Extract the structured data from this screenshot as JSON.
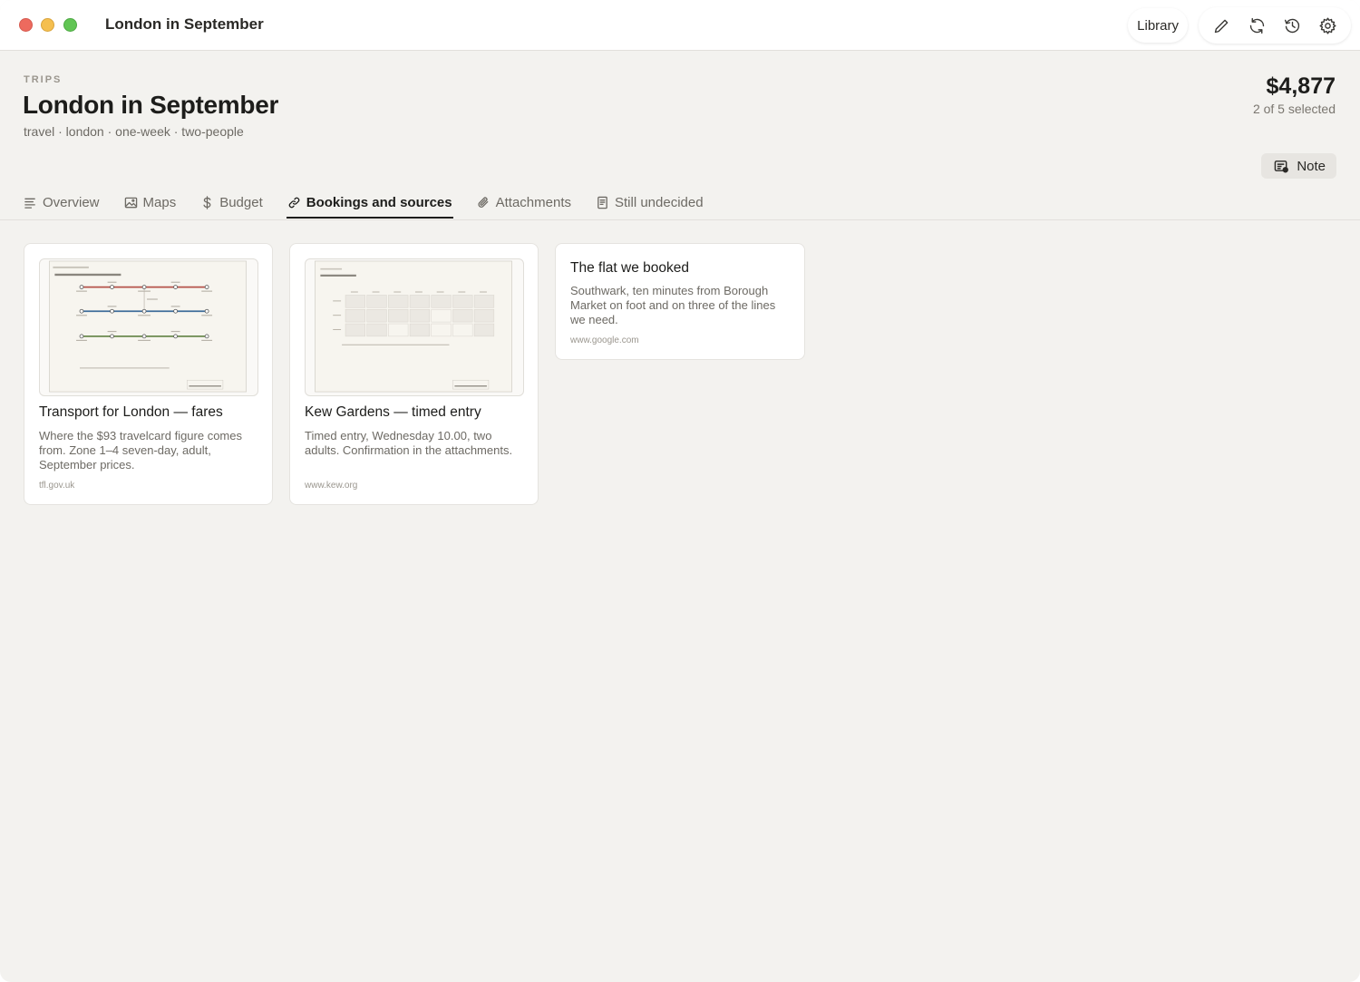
{
  "window": {
    "title": "London in September"
  },
  "toolbar": {
    "library_label": "Library",
    "icons": [
      "pencil-icon",
      "sync-icon",
      "history-icon",
      "gear-icon"
    ]
  },
  "header": {
    "breadcrumb": "TRIPS",
    "title": "London in September",
    "tags": "travel · london · one-week · two-people",
    "total": "$4,877",
    "selected": "2 of 5 selected",
    "note_label": "Note"
  },
  "tabs": [
    {
      "label": "Overview",
      "icon": "lines-icon",
      "active": false
    },
    {
      "label": "Maps",
      "icon": "image-icon",
      "active": false
    },
    {
      "label": "Budget",
      "icon": "dollar-icon",
      "active": false
    },
    {
      "label": "Bookings and sources",
      "icon": "link-icon",
      "active": true
    },
    {
      "label": "Attachments",
      "icon": "paperclip-icon",
      "active": false
    },
    {
      "label": "Still undecided",
      "icon": "document-icon",
      "active": false
    }
  ],
  "cards": [
    {
      "title": "Transport for London — fares",
      "description": "Where the $93 travelcard figure comes from. Zone 1–4 seven-day, adult, September prices.",
      "source": "tfl.gov.uk",
      "thumbnail": "transit-diagram"
    },
    {
      "title": "Kew Gardens — timed entry",
      "description": "Timed entry, Wednesday 10.00, two adults. Confirmation in the attachments.",
      "source": "www.kew.org",
      "thumbnail": "schedule-grid"
    },
    {
      "title": "The flat we booked",
      "description": "Southwark, ten minutes from Borough Market on foot and on three of the lines we need.",
      "source": "www.google.com"
    }
  ],
  "colors": {
    "background": "#f3f2ef",
    "card": "#ffffff",
    "text": "#1d1d1b",
    "muted": "#6d6a64",
    "line_red": "#b5534a",
    "line_blue": "#3f6d9a",
    "line_green": "#6b8a4e"
  }
}
